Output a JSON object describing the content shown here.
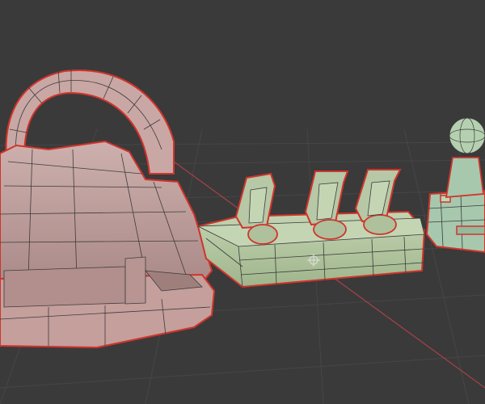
{
  "viewport": {
    "background": "#3a3a3a",
    "grid_color": "#464646",
    "x_axis_color": "#a2404a",
    "mesh_colors": {
      "wheel": "#c9a7a4",
      "pedals": "#b6c8a5",
      "shifter": "#a7c8ad",
      "wire": "#3c3c3c",
      "seam": "#d0342c"
    }
  },
  "objects": [
    {
      "id": "steering-wheel",
      "icon": "steering-wheel-mesh"
    },
    {
      "id": "pedal-set",
      "icon": "pedals-mesh"
    },
    {
      "id": "gear-shifter",
      "icon": "shifter-mesh"
    }
  ],
  "origin_marker": {
    "icon": "object-origin-icon"
  }
}
